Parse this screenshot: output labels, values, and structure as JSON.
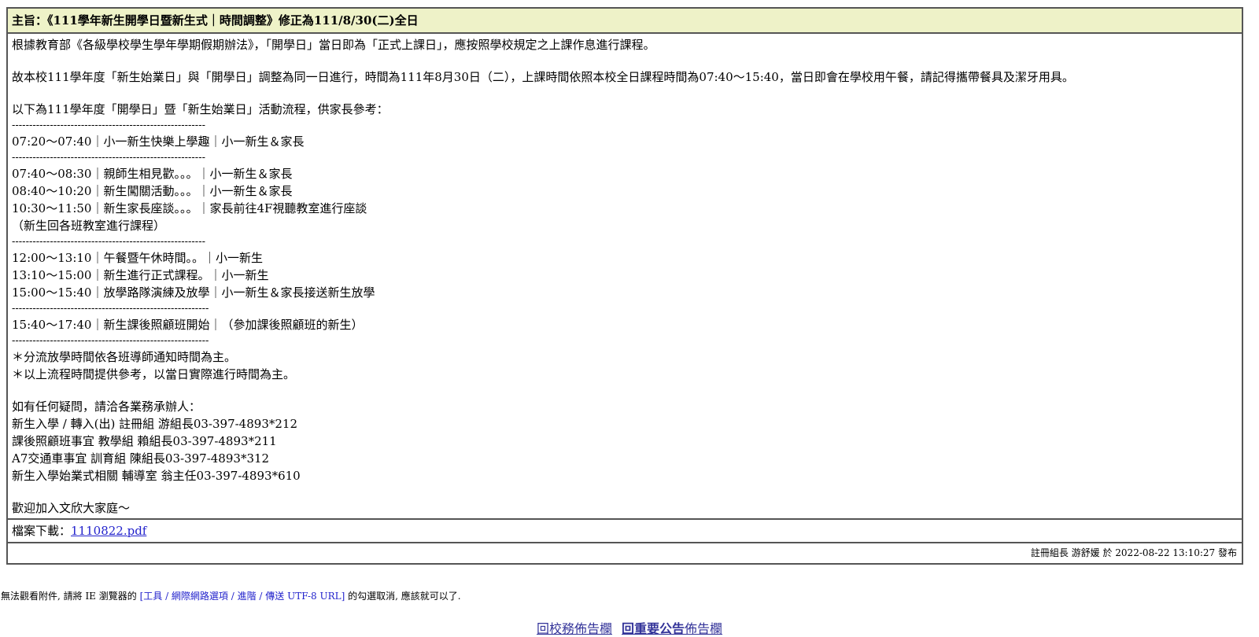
{
  "subject": "主旨：《111學年新生開學日暨新生式｜時間調整》修正為111/8/30(二)全日",
  "lines": [
    "根據教育部《各級學校學生學年學期假期辦法》，「開學日」當日即為「正式上課日」，應按照學校規定之上課作息進行課程。",
    "",
    "故本校111學年度「新生始業日」與「開學日」調整為同一日進行，時間為111年8月30日（二），上課時間依照本校全日課程時間為07:40～15:40，當日即會在學校用午餐，請記得攜帶餐具及潔牙用具。",
    "",
    "以下為111學年度「開學日」暨「新生始業日」活動流程，供家長參考：",
    "--------------------------------------------------------",
    "07:20～07:40｜小一新生快樂上學趣｜小一新生＆家長",
    "--------------------------------------------------------",
    "07:40～08:30｜親師生相見歡。。。｜小一新生＆家長",
    "08:40～10:20｜新生闖關活動。。。｜小一新生＆家長",
    "10:30～11:50｜新生家長座談。。。｜家長前往4F視聽教室進行座談",
    "（新生回各班教室進行課程）",
    "--------------------------------------------------------",
    "12:00～13:10｜午餐暨午休時間。。｜小一新生",
    "13:10～15:00｜新生進行正式課程。｜小一新生",
    "15:00～15:40｜放學路隊演練及放學｜小一新生＆家長接送新生放學",
    "---------------------------------------------------------",
    "15:40～17:40｜新生課後照顧班開始｜（參加課後照顧班的新生）",
    "---------------------------------------------------------",
    "＊分流放學時間依各班導師通知時間為主。",
    "＊以上流程時間提供參考，以當日實際進行時間為主。",
    "",
    "如有任何疑問，請洽各業務承辦人：",
    "新生入學 / 轉入(出) 註冊組 游組長03-397-4893*212",
    "課後照顧班事宜 教學組 賴組長03-397-4893*211",
    "A7交通車事宜 訓育組 陳組長03-397-4893*312",
    "新生入學始業式相關 輔導室 翁主任03-397-4893*610",
    "",
    "歡迎加入文欣大家庭～"
  ],
  "download": {
    "label": "檔案下載：",
    "file": "1110822.pdf"
  },
  "meta": "註冊組長 游舒媛 於 2022-08-22 13:10:27 發布",
  "note": {
    "prefix": "無法觀看附件, 請將 IE 瀏覽器的 ",
    "path": "[工具 / 網際網路選項 / 進階 / 傳送 UTF-8 URL]",
    "suffix": " 的勾選取消, 應該就可以了."
  },
  "nav": {
    "back_school": "回校務佈告欄",
    "back_important_bold": "回重要公告",
    "back_important_rest": "佈告欄"
  }
}
